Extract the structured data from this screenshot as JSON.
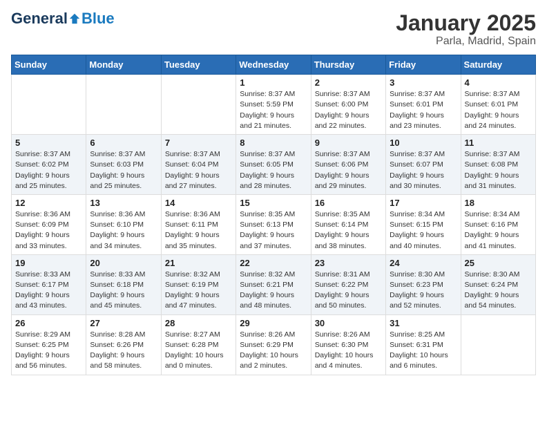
{
  "logo": {
    "general": "General",
    "blue": "Blue"
  },
  "title": "January 2025",
  "location": "Parla, Madrid, Spain",
  "weekdays": [
    "Sunday",
    "Monday",
    "Tuesday",
    "Wednesday",
    "Thursday",
    "Friday",
    "Saturday"
  ],
  "weeks": [
    [
      {
        "day": "",
        "info": ""
      },
      {
        "day": "",
        "info": ""
      },
      {
        "day": "",
        "info": ""
      },
      {
        "day": "1",
        "info": "Sunrise: 8:37 AM\nSunset: 5:59 PM\nDaylight: 9 hours\nand 21 minutes."
      },
      {
        "day": "2",
        "info": "Sunrise: 8:37 AM\nSunset: 6:00 PM\nDaylight: 9 hours\nand 22 minutes."
      },
      {
        "day": "3",
        "info": "Sunrise: 8:37 AM\nSunset: 6:01 PM\nDaylight: 9 hours\nand 23 minutes."
      },
      {
        "day": "4",
        "info": "Sunrise: 8:37 AM\nSunset: 6:01 PM\nDaylight: 9 hours\nand 24 minutes."
      }
    ],
    [
      {
        "day": "5",
        "info": "Sunrise: 8:37 AM\nSunset: 6:02 PM\nDaylight: 9 hours\nand 25 minutes."
      },
      {
        "day": "6",
        "info": "Sunrise: 8:37 AM\nSunset: 6:03 PM\nDaylight: 9 hours\nand 25 minutes."
      },
      {
        "day": "7",
        "info": "Sunrise: 8:37 AM\nSunset: 6:04 PM\nDaylight: 9 hours\nand 27 minutes."
      },
      {
        "day": "8",
        "info": "Sunrise: 8:37 AM\nSunset: 6:05 PM\nDaylight: 9 hours\nand 28 minutes."
      },
      {
        "day": "9",
        "info": "Sunrise: 8:37 AM\nSunset: 6:06 PM\nDaylight: 9 hours\nand 29 minutes."
      },
      {
        "day": "10",
        "info": "Sunrise: 8:37 AM\nSunset: 6:07 PM\nDaylight: 9 hours\nand 30 minutes."
      },
      {
        "day": "11",
        "info": "Sunrise: 8:37 AM\nSunset: 6:08 PM\nDaylight: 9 hours\nand 31 minutes."
      }
    ],
    [
      {
        "day": "12",
        "info": "Sunrise: 8:36 AM\nSunset: 6:09 PM\nDaylight: 9 hours\nand 33 minutes."
      },
      {
        "day": "13",
        "info": "Sunrise: 8:36 AM\nSunset: 6:10 PM\nDaylight: 9 hours\nand 34 minutes."
      },
      {
        "day": "14",
        "info": "Sunrise: 8:36 AM\nSunset: 6:11 PM\nDaylight: 9 hours\nand 35 minutes."
      },
      {
        "day": "15",
        "info": "Sunrise: 8:35 AM\nSunset: 6:13 PM\nDaylight: 9 hours\nand 37 minutes."
      },
      {
        "day": "16",
        "info": "Sunrise: 8:35 AM\nSunset: 6:14 PM\nDaylight: 9 hours\nand 38 minutes."
      },
      {
        "day": "17",
        "info": "Sunrise: 8:34 AM\nSunset: 6:15 PM\nDaylight: 9 hours\nand 40 minutes."
      },
      {
        "day": "18",
        "info": "Sunrise: 8:34 AM\nSunset: 6:16 PM\nDaylight: 9 hours\nand 41 minutes."
      }
    ],
    [
      {
        "day": "19",
        "info": "Sunrise: 8:33 AM\nSunset: 6:17 PM\nDaylight: 9 hours\nand 43 minutes."
      },
      {
        "day": "20",
        "info": "Sunrise: 8:33 AM\nSunset: 6:18 PM\nDaylight: 9 hours\nand 45 minutes."
      },
      {
        "day": "21",
        "info": "Sunrise: 8:32 AM\nSunset: 6:19 PM\nDaylight: 9 hours\nand 47 minutes."
      },
      {
        "day": "22",
        "info": "Sunrise: 8:32 AM\nSunset: 6:21 PM\nDaylight: 9 hours\nand 48 minutes."
      },
      {
        "day": "23",
        "info": "Sunrise: 8:31 AM\nSunset: 6:22 PM\nDaylight: 9 hours\nand 50 minutes."
      },
      {
        "day": "24",
        "info": "Sunrise: 8:30 AM\nSunset: 6:23 PM\nDaylight: 9 hours\nand 52 minutes."
      },
      {
        "day": "25",
        "info": "Sunrise: 8:30 AM\nSunset: 6:24 PM\nDaylight: 9 hours\nand 54 minutes."
      }
    ],
    [
      {
        "day": "26",
        "info": "Sunrise: 8:29 AM\nSunset: 6:25 PM\nDaylight: 9 hours\nand 56 minutes."
      },
      {
        "day": "27",
        "info": "Sunrise: 8:28 AM\nSunset: 6:26 PM\nDaylight: 9 hours\nand 58 minutes."
      },
      {
        "day": "28",
        "info": "Sunrise: 8:27 AM\nSunset: 6:28 PM\nDaylight: 10 hours\nand 0 minutes."
      },
      {
        "day": "29",
        "info": "Sunrise: 8:26 AM\nSunset: 6:29 PM\nDaylight: 10 hours\nand 2 minutes."
      },
      {
        "day": "30",
        "info": "Sunrise: 8:26 AM\nSunset: 6:30 PM\nDaylight: 10 hours\nand 4 minutes."
      },
      {
        "day": "31",
        "info": "Sunrise: 8:25 AM\nSunset: 6:31 PM\nDaylight: 10 hours\nand 6 minutes."
      },
      {
        "day": "",
        "info": ""
      }
    ]
  ]
}
